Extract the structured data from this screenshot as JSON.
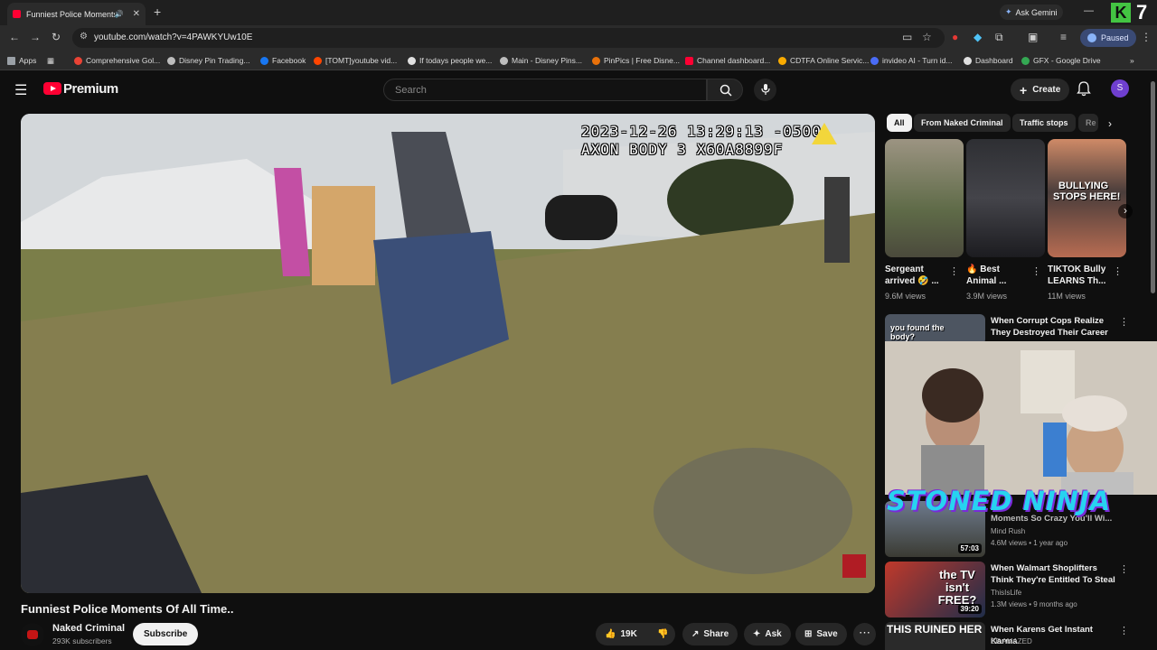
{
  "browser": {
    "tab_title": "Funniest Police Moments O",
    "new_tab": "+",
    "ask_gemini": "Ask Gemini",
    "extension_badge": "7",
    "url": "youtube.com/watch?v=4PAWKYUw10E",
    "profile_status": "Paused",
    "bookmarks": [
      {
        "label": "Apps",
        "color": "#9aa0a6"
      },
      {
        "label": "Comprehensive Gol...",
        "color": "#ea4335"
      },
      {
        "label": "Disney Pin Trading...",
        "color": "#bdbdbd"
      },
      {
        "label": "Facebook",
        "color": "#1877f2"
      },
      {
        "label": "[TOMT]youtube vid...",
        "color": "#ff4500"
      },
      {
        "label": "If todays people we...",
        "color": "#e0e0e0"
      },
      {
        "label": "Main - Disney Pins...",
        "color": "#bdbdbd"
      },
      {
        "label": "PinPics | Free Disne...",
        "color": "#e8710a"
      },
      {
        "label": "Channel dashboard...",
        "color": "#ff0033"
      },
      {
        "label": "CDTFA Online Servic...",
        "color": "#f9ab00"
      },
      {
        "label": "invideo AI - Turn id...",
        "color": "#4a6cf7"
      },
      {
        "label": "Dashboard",
        "color": "#e0e0e0"
      },
      {
        "label": "GFX - Google Drive",
        "color": "#34a853"
      }
    ]
  },
  "youtube": {
    "logo_text": "Premium",
    "search_placeholder": "Search",
    "create_label": "Create",
    "avatar_letter": "S"
  },
  "video": {
    "osd_line1": "2023-12-26 13:29:13 -0500",
    "osd_line2": "AXON BODY 3 X60A8899F",
    "title": "Funniest Police Moments Of All Time..",
    "channel": "Naked Criminal",
    "subscribers": "293K subscribers",
    "subscribe_label": "Subscribe",
    "likes": "19K",
    "share_label": "Share",
    "ask_label": "Ask",
    "save_label": "Save"
  },
  "chips": [
    "All",
    "From Naked Criminal",
    "Traffic stops",
    "Re"
  ],
  "shorts": [
    {
      "title": "Sergeant arrived 🤣 ...",
      "views": "9.6M views"
    },
    {
      "title": "🔥 Best Animal ...",
      "views": "3.9M views"
    },
    {
      "title": "TIKTOK Bully LEARNS Th...",
      "views": "11M views",
      "thumb_text1": "BULLYING",
      "thumb_text2": "STOPS HERE!"
    }
  ],
  "related": [
    {
      "title": "When Corrupt Cops Realize They Destroyed Their Career",
      "channel": "",
      "meta": "",
      "duration": "",
      "thumb_text": "you found the body?"
    },
    {
      "title": "Moments So Crazy You'll Wi...",
      "channel": "Mind Rush",
      "meta": "4.6M views • 1 year ago",
      "duration": "57:03",
      "thumb_text": ""
    },
    {
      "title": "When Walmart Shoplifters Think They're Entitled To Steal",
      "channel": "ThisIsLife",
      "meta": "1.3M views • 9 months ago",
      "duration": "39:20",
      "thumb_text": "the TV isn't FREE?"
    },
    {
      "title": "When Karens Get Instant Karma",
      "channel": "BE AMAZED",
      "meta": "",
      "duration": "",
      "thumb_text": "THIS RUINED HER"
    }
  ],
  "overlay": {
    "text": "STONED NINJA"
  }
}
